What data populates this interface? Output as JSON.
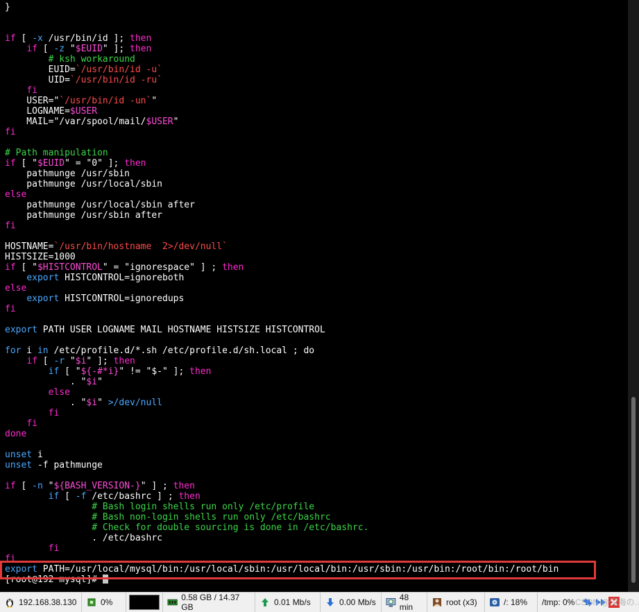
{
  "terminal": {
    "lines": [
      [
        {
          "t": "}",
          "c": ""
        }
      ],
      [],
      [],
      [
        {
          "t": "if",
          "c": "k"
        },
        {
          "t": " [ ",
          "c": ""
        },
        {
          "t": "-x",
          "c": "b"
        },
        {
          "t": " /usr/bin/id ]; ",
          "c": ""
        },
        {
          "t": "then",
          "c": "k"
        }
      ],
      [
        {
          "t": "    ",
          "c": ""
        },
        {
          "t": "if",
          "c": "k"
        },
        {
          "t": " [ ",
          "c": ""
        },
        {
          "t": "-z",
          "c": "b"
        },
        {
          "t": " \"",
          "c": ""
        },
        {
          "t": "$EUID",
          "c": "v"
        },
        {
          "t": "\" ]; ",
          "c": ""
        },
        {
          "t": "then",
          "c": "k"
        }
      ],
      [
        {
          "t": "        ",
          "c": ""
        },
        {
          "t": "# ksh workaround",
          "c": "c"
        }
      ],
      [
        {
          "t": "        EUID=",
          "c": ""
        },
        {
          "t": "`/usr/bin/id -u`",
          "c": "r"
        }
      ],
      [
        {
          "t": "        UID=",
          "c": ""
        },
        {
          "t": "`/usr/bin/id -ru`",
          "c": "r"
        }
      ],
      [
        {
          "t": "    ",
          "c": ""
        },
        {
          "t": "fi",
          "c": "k"
        }
      ],
      [
        {
          "t": "    USER=\"",
          "c": ""
        },
        {
          "t": "`/usr/bin/id -un`",
          "c": "r"
        },
        {
          "t": "\"",
          "c": ""
        }
      ],
      [
        {
          "t": "    LOGNAME=",
          "c": ""
        },
        {
          "t": "$USER",
          "c": "v"
        }
      ],
      [
        {
          "t": "    MAIL=\"/var/spool/mail/",
          "c": ""
        },
        {
          "t": "$USER",
          "c": "v"
        },
        {
          "t": "\"",
          "c": ""
        }
      ],
      [
        {
          "t": "fi",
          "c": "k"
        }
      ],
      [],
      [
        {
          "t": "# Path manipulation",
          "c": "c"
        }
      ],
      [
        {
          "t": "if",
          "c": "k"
        },
        {
          "t": " [ \"",
          "c": ""
        },
        {
          "t": "$EUID",
          "c": "v"
        },
        {
          "t": "\" = \"0\" ]; ",
          "c": ""
        },
        {
          "t": "then",
          "c": "k"
        }
      ],
      [
        {
          "t": "    pathmunge /usr/sbin",
          "c": ""
        }
      ],
      [
        {
          "t": "    pathmunge /usr/local/sbin",
          "c": ""
        }
      ],
      [
        {
          "t": "else",
          "c": "k"
        }
      ],
      [
        {
          "t": "    pathmunge /usr/local/sbin after",
          "c": ""
        }
      ],
      [
        {
          "t": "    pathmunge /usr/sbin after",
          "c": ""
        }
      ],
      [
        {
          "t": "fi",
          "c": "k"
        }
      ],
      [],
      [
        {
          "t": "HOSTNAME=",
          "c": ""
        },
        {
          "t": "`/usr/bin/hostname  2>/dev/null`",
          "c": "r"
        }
      ],
      [
        {
          "t": "HISTSIZE=1000",
          "c": ""
        }
      ],
      [
        {
          "t": "if",
          "c": "k"
        },
        {
          "t": " [ \"",
          "c": ""
        },
        {
          "t": "$HISTCONTROL",
          "c": "v"
        },
        {
          "t": "\" = \"ignorespace\" ] ; ",
          "c": ""
        },
        {
          "t": "then",
          "c": "k"
        }
      ],
      [
        {
          "t": "    ",
          "c": ""
        },
        {
          "t": "export",
          "c": "b"
        },
        {
          "t": " HISTCONTROL=ignoreboth",
          "c": ""
        }
      ],
      [
        {
          "t": "else",
          "c": "k"
        }
      ],
      [
        {
          "t": "    ",
          "c": ""
        },
        {
          "t": "export",
          "c": "b"
        },
        {
          "t": " HISTCONTROL=ignoredups",
          "c": ""
        }
      ],
      [
        {
          "t": "fi",
          "c": "k"
        }
      ],
      [],
      [
        {
          "t": "export",
          "c": "b"
        },
        {
          "t": " PATH USER LOGNAME MAIL HOSTNAME HISTSIZE HISTCONTROL",
          "c": ""
        }
      ],
      [],
      [
        {
          "t": "for",
          "c": "b"
        },
        {
          "t": " i ",
          "c": ""
        },
        {
          "t": "in",
          "c": "b"
        },
        {
          "t": " /etc/profile.d/*.sh /etc/profile.d/sh.local ; ",
          "c": ""
        },
        {
          "t": "do",
          "c": ""
        }
      ],
      [
        {
          "t": "    ",
          "c": ""
        },
        {
          "t": "if",
          "c": "k"
        },
        {
          "t": " [ ",
          "c": ""
        },
        {
          "t": "-r",
          "c": "b"
        },
        {
          "t": " \"",
          "c": ""
        },
        {
          "t": "$i",
          "c": "v"
        },
        {
          "t": "\" ]; ",
          "c": ""
        },
        {
          "t": "then",
          "c": "k"
        }
      ],
      [
        {
          "t": "        ",
          "c": ""
        },
        {
          "t": "if",
          "c": "b"
        },
        {
          "t": " [ \"",
          "c": ""
        },
        {
          "t": "${-#*i}",
          "c": "v"
        },
        {
          "t": "\" != \"$-\" ]; ",
          "c": ""
        },
        {
          "t": "then",
          "c": "k"
        }
      ],
      [
        {
          "t": "            . \"",
          "c": ""
        },
        {
          "t": "$i",
          "c": "v"
        },
        {
          "t": "\"",
          "c": ""
        }
      ],
      [
        {
          "t": "        ",
          "c": ""
        },
        {
          "t": "else",
          "c": "k"
        }
      ],
      [
        {
          "t": "            . \"",
          "c": ""
        },
        {
          "t": "$i",
          "c": "v"
        },
        {
          "t": "\" ",
          "c": ""
        },
        {
          "t": ">/dev/null",
          "c": "b"
        }
      ],
      [
        {
          "t": "        ",
          "c": ""
        },
        {
          "t": "fi",
          "c": "k"
        }
      ],
      [
        {
          "t": "    ",
          "c": ""
        },
        {
          "t": "fi",
          "c": "k"
        }
      ],
      [
        {
          "t": "done",
          "c": "k"
        }
      ],
      [],
      [
        {
          "t": "unset",
          "c": "b"
        },
        {
          "t": " i",
          "c": ""
        }
      ],
      [
        {
          "t": "unset",
          "c": "b"
        },
        {
          "t": " -f pathmunge",
          "c": ""
        }
      ],
      [],
      [
        {
          "t": "if",
          "c": "k"
        },
        {
          "t": " [ ",
          "c": ""
        },
        {
          "t": "-n",
          "c": "b"
        },
        {
          "t": " \"",
          "c": ""
        },
        {
          "t": "${BASH_VERSION-}",
          "c": "v"
        },
        {
          "t": "\" ] ; ",
          "c": ""
        },
        {
          "t": "then",
          "c": "k"
        }
      ],
      [
        {
          "t": "        ",
          "c": ""
        },
        {
          "t": "if",
          "c": "b"
        },
        {
          "t": " [ ",
          "c": ""
        },
        {
          "t": "-f",
          "c": "b"
        },
        {
          "t": " /etc/bashrc ] ; ",
          "c": ""
        },
        {
          "t": "then",
          "c": "k"
        }
      ],
      [
        {
          "t": "                ",
          "c": ""
        },
        {
          "t": "# Bash login shells run only /etc/profile",
          "c": "c"
        }
      ],
      [
        {
          "t": "                ",
          "c": ""
        },
        {
          "t": "# Bash non-login shells run only /etc/bashrc",
          "c": "c"
        }
      ],
      [
        {
          "t": "                ",
          "c": ""
        },
        {
          "t": "# Check for double sourcing is done in /etc/bashrc.",
          "c": "c"
        }
      ],
      [
        {
          "t": "                . /etc/bashrc",
          "c": ""
        }
      ],
      [
        {
          "t": "        ",
          "c": ""
        },
        {
          "t": "fi",
          "c": "k"
        }
      ],
      [
        {
          "t": "fi",
          "c": "k"
        }
      ],
      [
        {
          "t": "export",
          "c": "b"
        },
        {
          "t": " PATH=/usr/local/mysql/bin:/usr/local/sbin:/usr/local/bin:/usr/sbin:/usr/bin:/root/bin:/root/bin",
          "c": ""
        }
      ],
      [
        {
          "t": "[root@192 mysql]# ",
          "c": ""
        }
      ]
    ]
  },
  "statusbar": {
    "ip": "192.168.38.130",
    "cpu": "0%",
    "memory": "0.58 GB / 14.37 GB",
    "upload": "0.01 Mb/s",
    "download": "0.00 Mb/s",
    "uptime": "48 min",
    "user": "root (x3)",
    "disk_root": "/: 18%",
    "disk_tmp": "/tmp: 0%",
    "watermark": "CSDN @深海の..."
  }
}
